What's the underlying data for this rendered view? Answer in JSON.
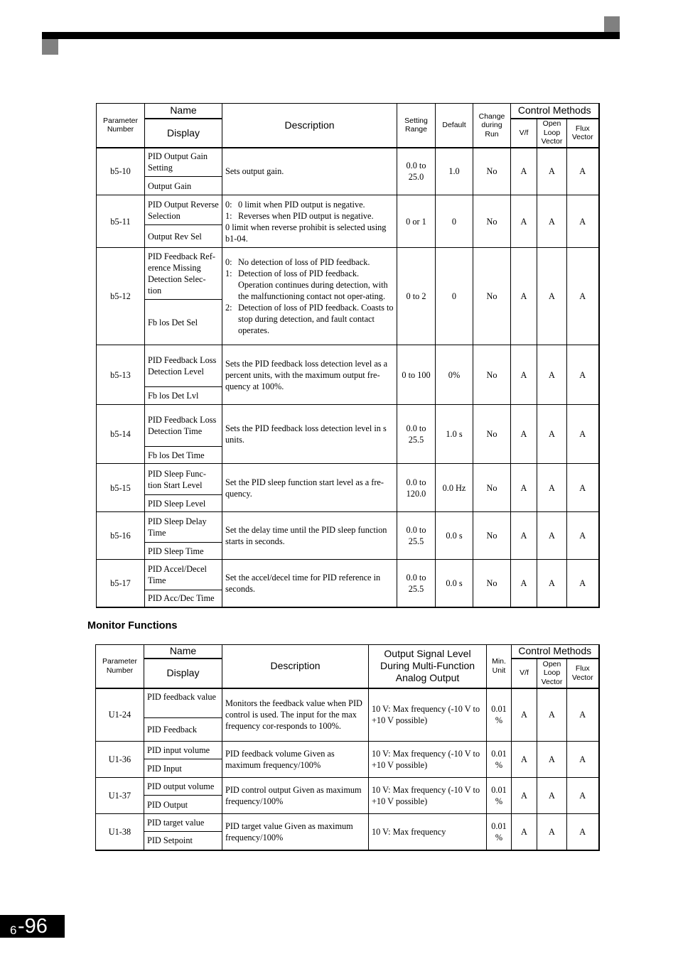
{
  "page": {
    "chapter": "6",
    "page_number": "-96"
  },
  "table1": {
    "headers": {
      "param_number": "Parameter Number",
      "name": "Name",
      "display": "Display",
      "description": "Description",
      "setting_range": "Setting Range",
      "default": "Default",
      "change_during_run": "Change during Run",
      "control_methods": "Control Methods",
      "vf": "V/f",
      "olv": "Open Loop Vector",
      "flux": "Flux Vector"
    },
    "rows": [
      {
        "number": "b5-10",
        "name": "PID Output Gain Setting",
        "display": "Output Gain",
        "description": [
          "Sets output gain."
        ],
        "range": "0.0 to 25.0",
        "default": "1.0",
        "change": "No",
        "vf": "A",
        "olv": "A",
        "flux": "A"
      },
      {
        "number": "b5-11",
        "name": "PID Output Reverse Selection",
        "display": "Output Rev Sel",
        "description": [
          "0:|0 limit when PID output is negative.",
          "1:|Reverses when PID output is negative.",
          "0 limit when reverse prohibit is selected using b1-04."
        ],
        "range": "0 or 1",
        "default": "0",
        "change": "No",
        "vf": "A",
        "olv": "A",
        "flux": "A"
      },
      {
        "number": "b5-12",
        "name": "PID Feedback Ref-erence Missing Detection Selec-tion",
        "display": "Fb los Det Sel",
        "description": [
          "0:|No detection of loss of PID feedback.",
          "1:|Detection of loss of PID feedback. Operation continues during detection, with the malfunctioning contact not oper-ating.",
          "2:|Detection of loss of PID feedback. Coasts to stop during detection, and fault contact operates."
        ],
        "range": "0 to 2",
        "default": "0",
        "change": "No",
        "vf": "A",
        "olv": "A",
        "flux": "A"
      },
      {
        "number": "b5-13",
        "name": "PID Feedback Loss Detection Level",
        "display": "Fb los Det Lvl",
        "description": [
          "Sets the PID feedback loss detection level as a percent units, with the maximum output fre-quency at 100%."
        ],
        "range": "0 to 100",
        "default": "0%",
        "change": "No",
        "vf": "A",
        "olv": "A",
        "flux": "A"
      },
      {
        "number": "b5-14",
        "name": "PID Feedback Loss Detection Time",
        "display": "Fb los Det Time",
        "description": [
          "Sets the PID feedback loss detection level in s units."
        ],
        "range": "0.0 to 25.5",
        "default": "1.0 s",
        "change": "No",
        "vf": "A",
        "olv": "A",
        "flux": "A"
      },
      {
        "number": "b5-15",
        "name": "PID Sleep Func-tion Start Level",
        "display": "PID Sleep Level",
        "description": [
          "Set the PID sleep function start level as a fre-quency."
        ],
        "range": "0.0 to 120.0",
        "default": "0.0 Hz",
        "change": "No",
        "vf": "A",
        "olv": "A",
        "flux": "A"
      },
      {
        "number": "b5-16",
        "name": "PID Sleep Delay Time",
        "display": "PID Sleep Time",
        "description": [
          "Set the delay time until the PID sleep function starts in seconds."
        ],
        "range": "0.0 to 25.5",
        "default": "0.0 s",
        "change": "No",
        "vf": "A",
        "olv": "A",
        "flux": "A"
      },
      {
        "number": "b5-17",
        "name": "PID Accel/Decel Time",
        "display": "PID Acc/Dec Time",
        "description": [
          "Set the accel/decel time for PID reference in seconds."
        ],
        "range": "0.0 to 25.5",
        "default": "0.0 s",
        "change": "No",
        "vf": "A",
        "olv": "A",
        "flux": "A"
      }
    ]
  },
  "section_title": "Monitor Functions",
  "table2": {
    "headers": {
      "param_number": "Parameter Number",
      "name": "Name",
      "display": "Display",
      "description": "Description",
      "output_signal": "Output Signal Level During Multi-Function Analog Output",
      "min_unit": "Min. Unit",
      "control_methods": "Control Methods",
      "vf": "V/f",
      "olv": "Open Loop Vector",
      "flux": "Flux Vector"
    },
    "rows": [
      {
        "number": "U1-24",
        "name": "PID feedback value",
        "display": "PID Feedback",
        "description": "Monitors the feedback value when PID control is used. The input for the max frequency cor-responds to 100%.",
        "output": "10 V: Max frequency (-10 V to +10 V possible)",
        "min_unit": "0.01 %",
        "vf": "A",
        "olv": "A",
        "flux": "A"
      },
      {
        "number": "U1-36",
        "name": "PID input volume",
        "display": "PID Input",
        "description": "PID feedback volume Given as maximum frequency/100%",
        "output": "10 V: Max frequency (-10 V to +10 V possible)",
        "min_unit": "0.01 %",
        "vf": "A",
        "olv": "A",
        "flux": "A"
      },
      {
        "number": "U1-37",
        "name": "PID output volume",
        "display": "PID Output",
        "description": "PID control output Given as maximum frequency/100%",
        "output": "10 V: Max frequency (-10 V to +10 V possible)",
        "min_unit": "0.01 %",
        "vf": "A",
        "olv": "A",
        "flux": "A"
      },
      {
        "number": "U1-38",
        "name": "PID target value",
        "display": "PID Setpoint",
        "description": "PID target value Given as maximum frequency/100%",
        "output": "10 V: Max frequency",
        "min_unit": "0.01 %",
        "vf": "A",
        "olv": "A",
        "flux": "A"
      }
    ]
  }
}
